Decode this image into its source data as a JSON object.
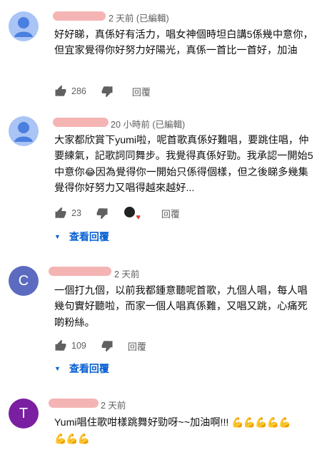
{
  "comments": [
    {
      "avatar": "person-icon",
      "meta": "2 天前 (已編輯)",
      "text": "好好睇，真係好有活力，唱女神個時坦白講5係幾中意你，但宜家覺得你好努力好陽光，真係一首比一首好，加油",
      "likes": "286",
      "reply_label": "回覆"
    },
    {
      "avatar": "person-icon",
      "meta": "20 小時前 (已編輯)",
      "text_before_emoji": "大家都欣賞下yumi啦，呢首歌真係好難唱，要跳住唱，仲要練氣，記歌詞同舞步。我覺得真係好勁。我承認一開始5中意你",
      "emoji": "😂",
      "text_after_emoji": "因為覺得你一開始只係得個樣，但之後睇多幾集覺得你好努力又唱得越來越好...",
      "likes": "23",
      "reply_label": "回覆",
      "view_replies": "查看回覆"
    },
    {
      "avatar_letter": "C",
      "avatar_color": "#5c6bc0",
      "meta": "2 天前",
      "text": "一個打九個，以前我都鍾意聽呢首歌，九個人唱，每人唱幾句實好聽啦，而家一個人唱真係難，又唱又跳，心痛死啲粉絲。",
      "likes": "109",
      "reply_label": "回覆",
      "view_replies": "查看回覆"
    },
    {
      "avatar_letter": "T",
      "avatar_color": "#7b1fa2",
      "meta": "2 天前",
      "text": "Yumi唱住歌咁樣跳舞好勁呀~~加油啊!!!",
      "emoji_row1": "💪💪💪💪💪",
      "emoji_row2": "💪💪💪"
    }
  ],
  "colors": {
    "link": "#065fd4",
    "meta": "#606060",
    "redaction": "#f5b4b4",
    "default_avatar": "#a9c4f5"
  }
}
